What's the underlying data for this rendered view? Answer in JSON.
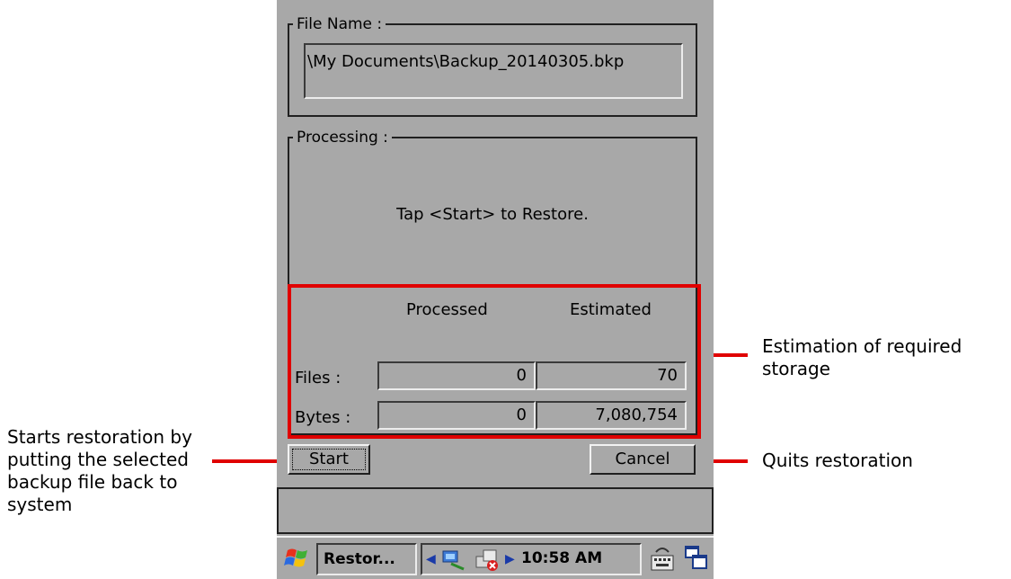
{
  "dialog": {
    "file_name_label": "File Name :",
    "file_path": "\\My Documents\\Backup_20140305.bkp",
    "processing_label": "Processing :",
    "status_message": "Tap <Start> to Restore.",
    "columns": {
      "processed": "Processed",
      "estimated": "Estimated"
    },
    "rows": {
      "files": {
        "label": "Files :",
        "processed": "0",
        "estimated": "70"
      },
      "bytes": {
        "label": "Bytes :",
        "processed": "0",
        "estimated": "7,080,754"
      }
    },
    "start_label": "Start",
    "cancel_label": "Cancel"
  },
  "taskbar": {
    "task_label": "Restor...",
    "time": "10:58 AM"
  },
  "annotations": {
    "estimation": "Estimation of required storage",
    "start": "Starts restoration by putting the selected backup file back to system",
    "quit": "Quits restoration"
  },
  "colors": {
    "highlight": "#e00000",
    "window_bg": "#a8a8a8"
  }
}
